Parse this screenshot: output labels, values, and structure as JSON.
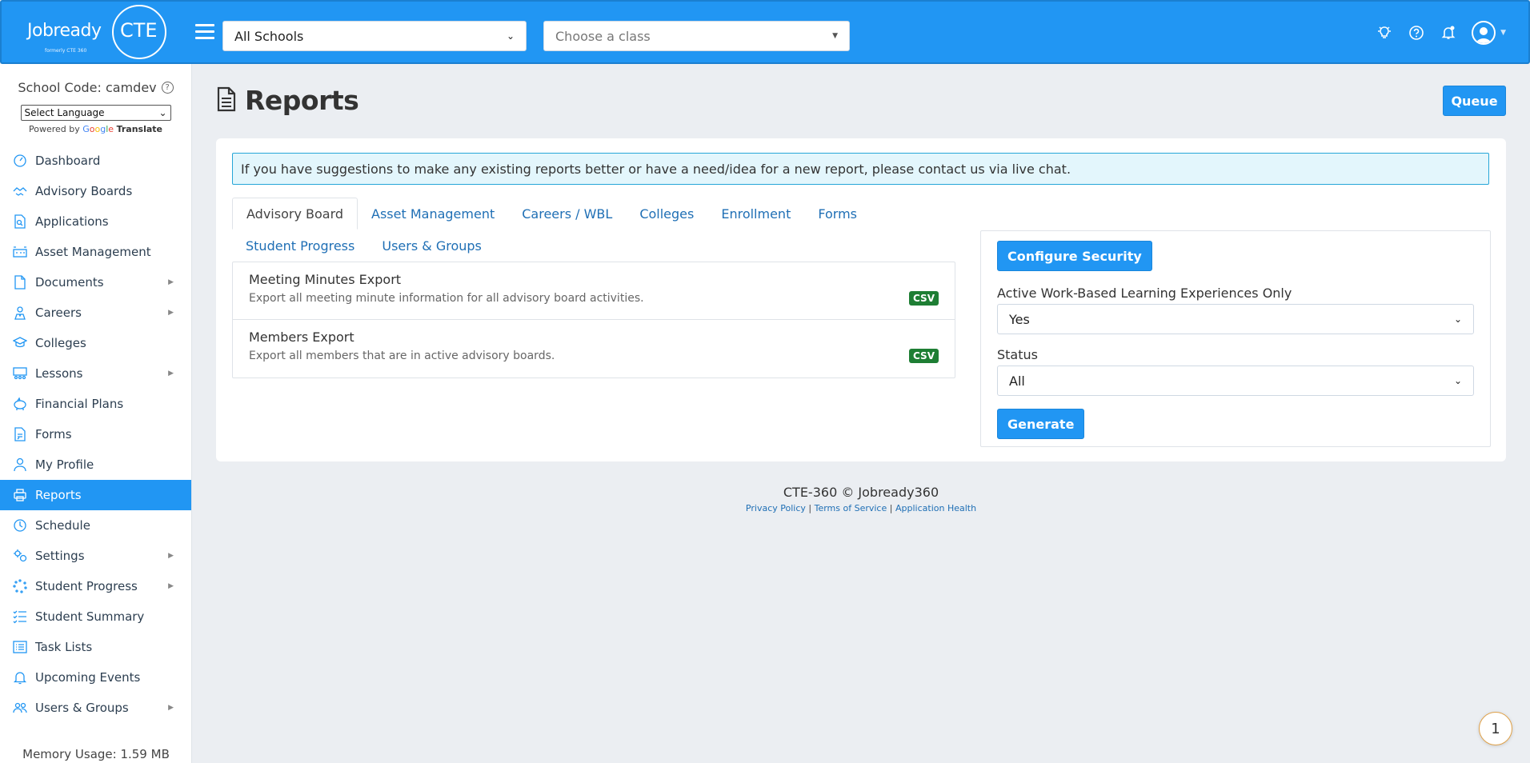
{
  "header": {
    "logo_word": "Jobready",
    "logo_cte": "CTE",
    "logo_sub": "formerly CTE 360",
    "school_select": "All Schools",
    "class_placeholder": "Choose a class"
  },
  "sidebar": {
    "school_code": "School Code: camdev",
    "language_select": "Select Language",
    "powered_by": "Powered by",
    "google": [
      "G",
      "o",
      "o",
      "g",
      "l",
      "e"
    ],
    "translate": "Translate",
    "items": [
      {
        "label": "Dashboard",
        "icon": "dashboard-icon",
        "has_arrow": false
      },
      {
        "label": "Advisory Boards",
        "icon": "handshake-icon",
        "has_arrow": false
      },
      {
        "label": "Applications",
        "icon": "file-search-icon",
        "has_arrow": false
      },
      {
        "label": "Asset Management",
        "icon": "asset-icon",
        "has_arrow": false
      },
      {
        "label": "Documents",
        "icon": "document-icon",
        "has_arrow": true
      },
      {
        "label": "Careers",
        "icon": "career-icon",
        "has_arrow": true
      },
      {
        "label": "Colleges",
        "icon": "graduation-cap-icon",
        "has_arrow": false
      },
      {
        "label": "Lessons",
        "icon": "lessons-icon",
        "has_arrow": true
      },
      {
        "label": "Financial Plans",
        "icon": "piggy-bank-icon",
        "has_arrow": false
      },
      {
        "label": "Forms",
        "icon": "form-icon",
        "has_arrow": false
      },
      {
        "label": "My Profile",
        "icon": "user-icon",
        "has_arrow": false
      },
      {
        "label": "Reports",
        "icon": "printer-icon",
        "has_arrow": false,
        "active": true
      },
      {
        "label": "Schedule",
        "icon": "clock-icon",
        "has_arrow": false
      },
      {
        "label": "Settings",
        "icon": "gears-icon",
        "has_arrow": true
      },
      {
        "label": "Student Progress",
        "icon": "spinner-icon",
        "has_arrow": true
      },
      {
        "label": "Student Summary",
        "icon": "checklist-icon",
        "has_arrow": false
      },
      {
        "label": "Task Lists",
        "icon": "list-icon",
        "has_arrow": false
      },
      {
        "label": "Upcoming Events",
        "icon": "bell-icon",
        "has_arrow": false
      },
      {
        "label": "Users & Groups",
        "icon": "users-icon",
        "has_arrow": true
      }
    ],
    "memory": "Memory Usage: 1.59 MB"
  },
  "main": {
    "title": "Reports",
    "queue_label": "Queue",
    "alert": "If you have suggestions to make any existing reports better or have a need/idea for a new report, please contact us via live chat.",
    "tabs_row1": [
      "Advisory Board",
      "Asset Management",
      "Careers / WBL",
      "Colleges",
      "Enrollment",
      "Forms"
    ],
    "tabs_row2": [
      "Student Progress",
      "Users & Groups"
    ],
    "reports": [
      {
        "title": "Meeting Minutes Export",
        "desc": "Export all meeting minute information for all advisory board activities.",
        "badge": "CSV"
      },
      {
        "title": "Members Export",
        "desc": "Export all members that are in active advisory boards.",
        "badge": "CSV"
      }
    ],
    "options": {
      "configure_label": "Configure Security",
      "wbl_label": "Active Work-Based Learning Experiences Only",
      "wbl_value": "Yes",
      "status_label": "Status",
      "status_value": "All",
      "generate_label": "Generate"
    }
  },
  "footer": {
    "main": "CTE-360 © Jobready360",
    "privacy": "Privacy Policy",
    "terms": "Terms of Service",
    "health": "Application Health",
    "sep": "|"
  },
  "chat_bubble": "1",
  "colors": {
    "primary": "#2196f3",
    "csv_badge": "#1e7e34",
    "alert_bg": "#e3f6fc"
  }
}
